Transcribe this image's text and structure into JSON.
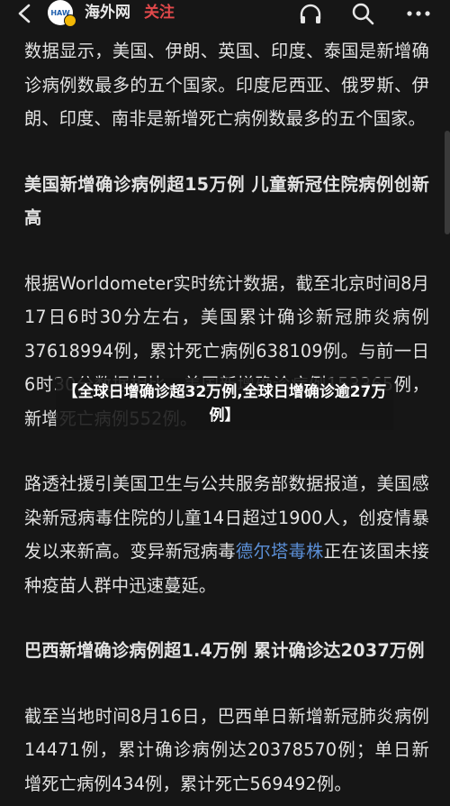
{
  "topbar": {
    "back_icon": "back-arrow-icon",
    "avatar_text": "HAW",
    "account_name": "海外网",
    "follow_label": "关注",
    "icons": [
      "headphones-icon",
      "search-icon",
      "more-icon"
    ]
  },
  "article": {
    "p1": "数据显示，美国、伊朗、英国、印度、泰国是新增确诊病例数最多的五个国家。印度尼西亚、俄罗斯、伊朗、印度、南非是新增死亡病例数最多的五个国家。",
    "h1": "美国新增确诊病例超15万例 儿童新冠住院病例创新高",
    "p2": "根据Worldometer实时统计数据，截至北京时间8月17日6时30分左右，美国累计确诊新冠肺炎病例37618994例，累计死亡病例638109例。与前一日6时30分数据相比，美国新增确诊病例153365例，新增死亡病例552例。",
    "p3_before": "路透社援引美国卫生与公共服务部数据报道，美国感染新冠病毒住院的儿童14日超过1900人，创疫情暴发以来新高。变异新冠病毒",
    "p3_link": "德尔塔毒株",
    "p3_after": "正在该国未接种疫苗人群中迅速蔓延。",
    "h2": "巴西新增确诊病例超1.4万例 累计确诊达2037万例",
    "p4": "截至当地时间8月16日，巴西单日新增新冠肺炎病例14471例，累计确诊病例达20378570例；单日新增死亡病例434例，累计死亡569492例。"
  },
  "overlay": {
    "title": "【全球日增确诊超32万例,全球日增确诊逾27万例】"
  },
  "colors": {
    "background": "#161616",
    "text": "#e3e3e3",
    "follow": "#e2494b",
    "link": "#5b8fd6"
  }
}
